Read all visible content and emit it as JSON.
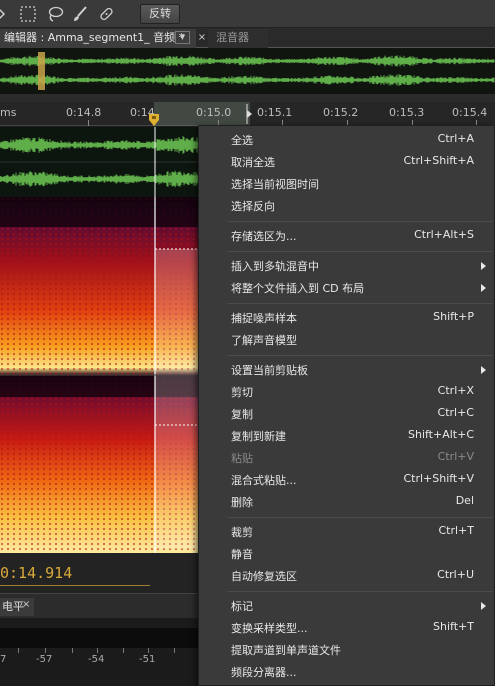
{
  "toolbar": {
    "reverse_label": "反转",
    "tools": [
      "marquee-select-icon",
      "lasso-icon",
      "brush-icon",
      "spot-healing-icon"
    ]
  },
  "tabs": {
    "editor_label": "编辑器 : Amma_segment1_ 音频 *",
    "editor_dropdown": "▼",
    "editor_close": "×",
    "mixer_label": "混音器"
  },
  "ruler": {
    "unit_label": "ms",
    "ticks": [
      "0:14.8",
      "0:14.9",
      "0:15.0",
      "0:15.1",
      "0:15.2",
      "0:15.3",
      "0:15.4"
    ],
    "partial_tick": "0:14"
  },
  "time_display": "0:14.914",
  "level_panel": {
    "tab_label": "电平",
    "close_label": "×",
    "db_ticks": [
      "-57",
      "-54",
      "-51"
    ],
    "partial_db": "7"
  },
  "colors": {
    "accent": "#d9a93a",
    "waveform": "#5fae4a",
    "menu_bg": "#3a3a3a",
    "selection_line": "#ffffff"
  },
  "context_menu": {
    "items": [
      {
        "label": "全选",
        "shortcut": "Ctrl+A"
      },
      {
        "label": "取消全选",
        "shortcut": "Ctrl+Shift+A"
      },
      {
        "label": "选择当前视图时间",
        "shortcut": ""
      },
      {
        "label": "选择反向",
        "shortcut": ""
      },
      {
        "label": "存储选区为...",
        "shortcut": "Ctrl+Alt+S"
      },
      {
        "label": "插入到多轨混音中",
        "shortcut": "",
        "submenu": true
      },
      {
        "label": "将整个文件插入到 CD 布局",
        "shortcut": "",
        "submenu": true
      },
      {
        "label": "捕捉噪声样本",
        "shortcut": "Shift+P"
      },
      {
        "label": "了解声音模型",
        "shortcut": ""
      },
      {
        "label": "设置当前剪贴板",
        "shortcut": "",
        "submenu": true
      },
      {
        "label": "剪切",
        "shortcut": "Ctrl+X"
      },
      {
        "label": "复制",
        "shortcut": "Ctrl+C"
      },
      {
        "label": "复制到新建",
        "shortcut": "Shift+Alt+C"
      },
      {
        "label": "粘贴",
        "shortcut": "Ctrl+V",
        "disabled": true
      },
      {
        "label": "混合式粘贴...",
        "shortcut": "Ctrl+Shift+V"
      },
      {
        "label": "删除",
        "shortcut": "Del"
      },
      {
        "label": "裁剪",
        "shortcut": "Ctrl+T"
      },
      {
        "label": "静音",
        "shortcut": ""
      },
      {
        "label": "自动修复选区",
        "shortcut": "Ctrl+U"
      },
      {
        "label": "标记",
        "shortcut": "",
        "submenu": true
      },
      {
        "label": "变换采样类型...",
        "shortcut": "Shift+T"
      },
      {
        "label": "提取声道到单声道文件",
        "shortcut": ""
      },
      {
        "label": "频段分离器...",
        "shortcut": ""
      }
    ]
  }
}
